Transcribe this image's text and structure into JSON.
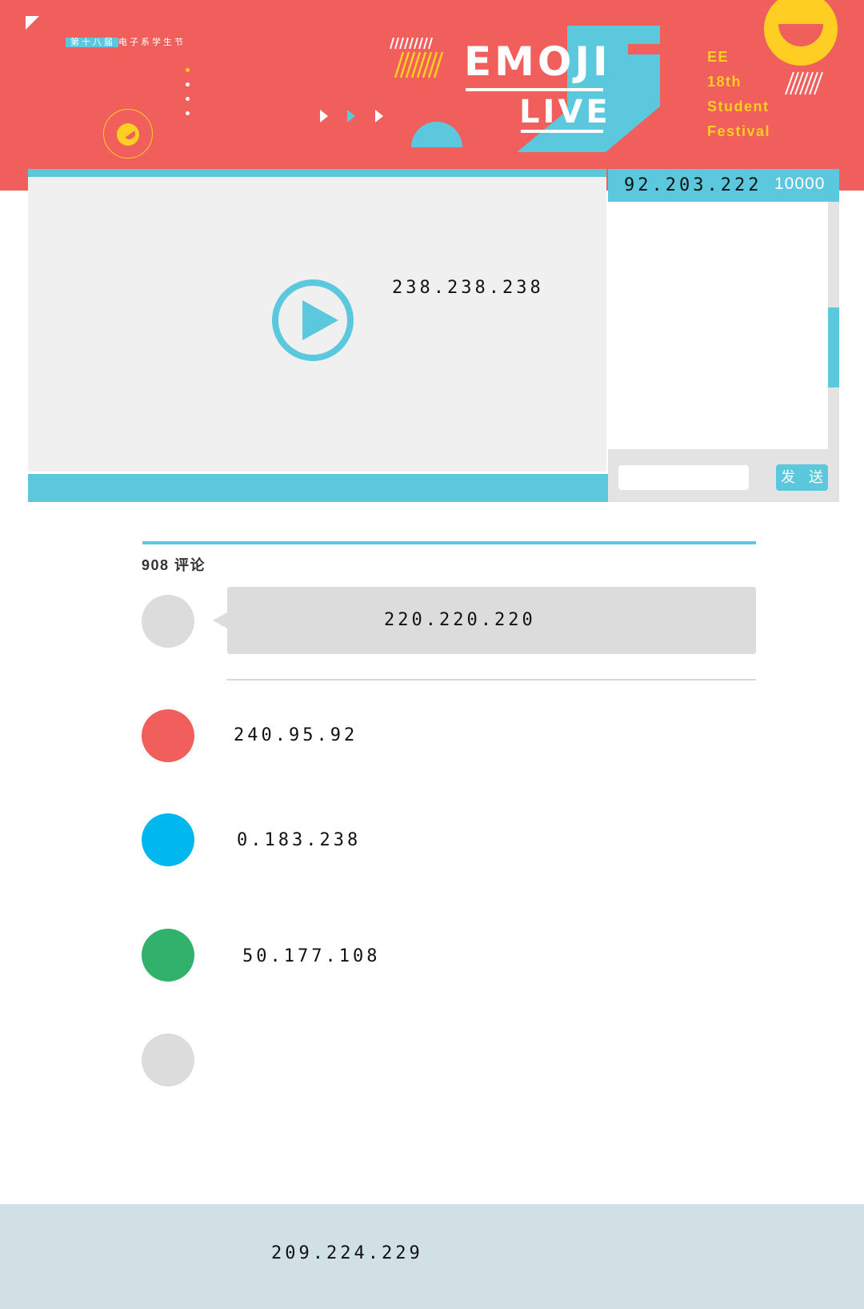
{
  "header": {
    "festival_tag_highlight": "第十八届",
    "festival_tag_rest": "电子系学生节",
    "logo_line1": "EMOJI",
    "logo_line2": "LIVE",
    "side_text": [
      "EE",
      "18th",
      "Student",
      "Festival"
    ],
    "colors": {
      "background": "#f05f5c",
      "accent_blue": "#5bc8de",
      "accent_yellow": "#ffce22"
    }
  },
  "player": {
    "background_label": "238.238.238",
    "play_icon": "play-circle-icon"
  },
  "chat": {
    "header_color_label": "92.203.222",
    "viewer_count": "10000",
    "input_value": "",
    "send_label": "发 送"
  },
  "comments": {
    "count_label": "908 评论",
    "input_bubble_label": "220.220.220",
    "items": [
      {
        "avatar_color": "#f05f5c",
        "text": "240.95.92"
      },
      {
        "avatar_color": "#00b7ee",
        "text": "0.183.238"
      },
      {
        "avatar_color": "#32b16c",
        "text": "50.177.108"
      },
      {
        "avatar_color": "#dcdcdc",
        "text": ""
      }
    ]
  },
  "footer": {
    "label": "209.224.229"
  }
}
